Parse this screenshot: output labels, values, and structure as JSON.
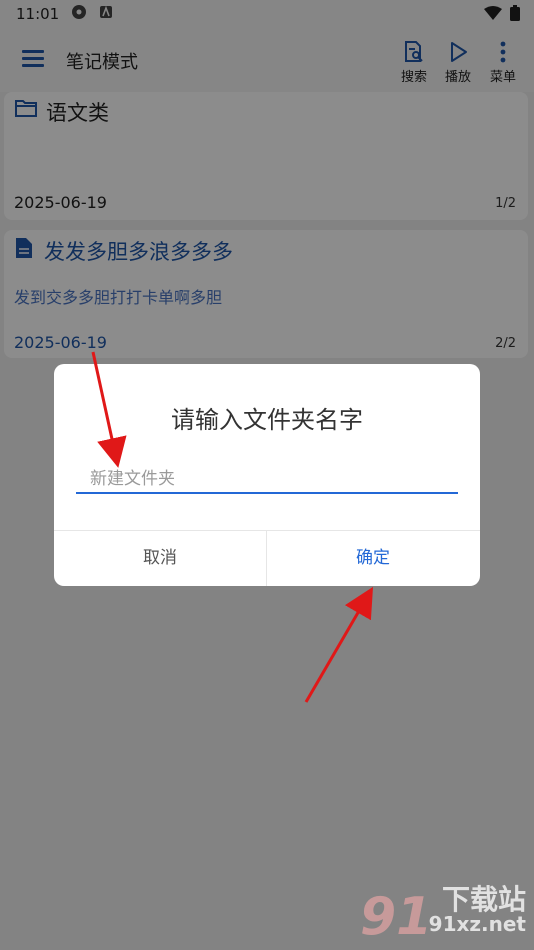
{
  "status_bar": {
    "time": "11:01"
  },
  "app_bar": {
    "title": "笔记模式",
    "actions": [
      {
        "label": "搜索"
      },
      {
        "label": "播放"
      },
      {
        "label": "菜单"
      }
    ]
  },
  "cards": [
    {
      "type": "folder",
      "title": "语文类",
      "date": "2025-06-19",
      "page": "1/2"
    },
    {
      "type": "note",
      "title": "发发多胆多浪多多多",
      "body": "发到交多多胆打打卡单啊多胆",
      "date": "2025-06-19",
      "page": "2/2"
    }
  ],
  "dialog": {
    "title": "请输入文件夹名字",
    "input_placeholder": "新建文件夹",
    "input_value": "",
    "cancel_label": "取消",
    "confirm_label": "确定"
  },
  "watermark": {
    "site": "91xz.net",
    "tagline": "下载站"
  },
  "colors": {
    "accent": "#2368d6",
    "nav_blue": "#1f56a8",
    "annotation_red": "#e01818"
  }
}
